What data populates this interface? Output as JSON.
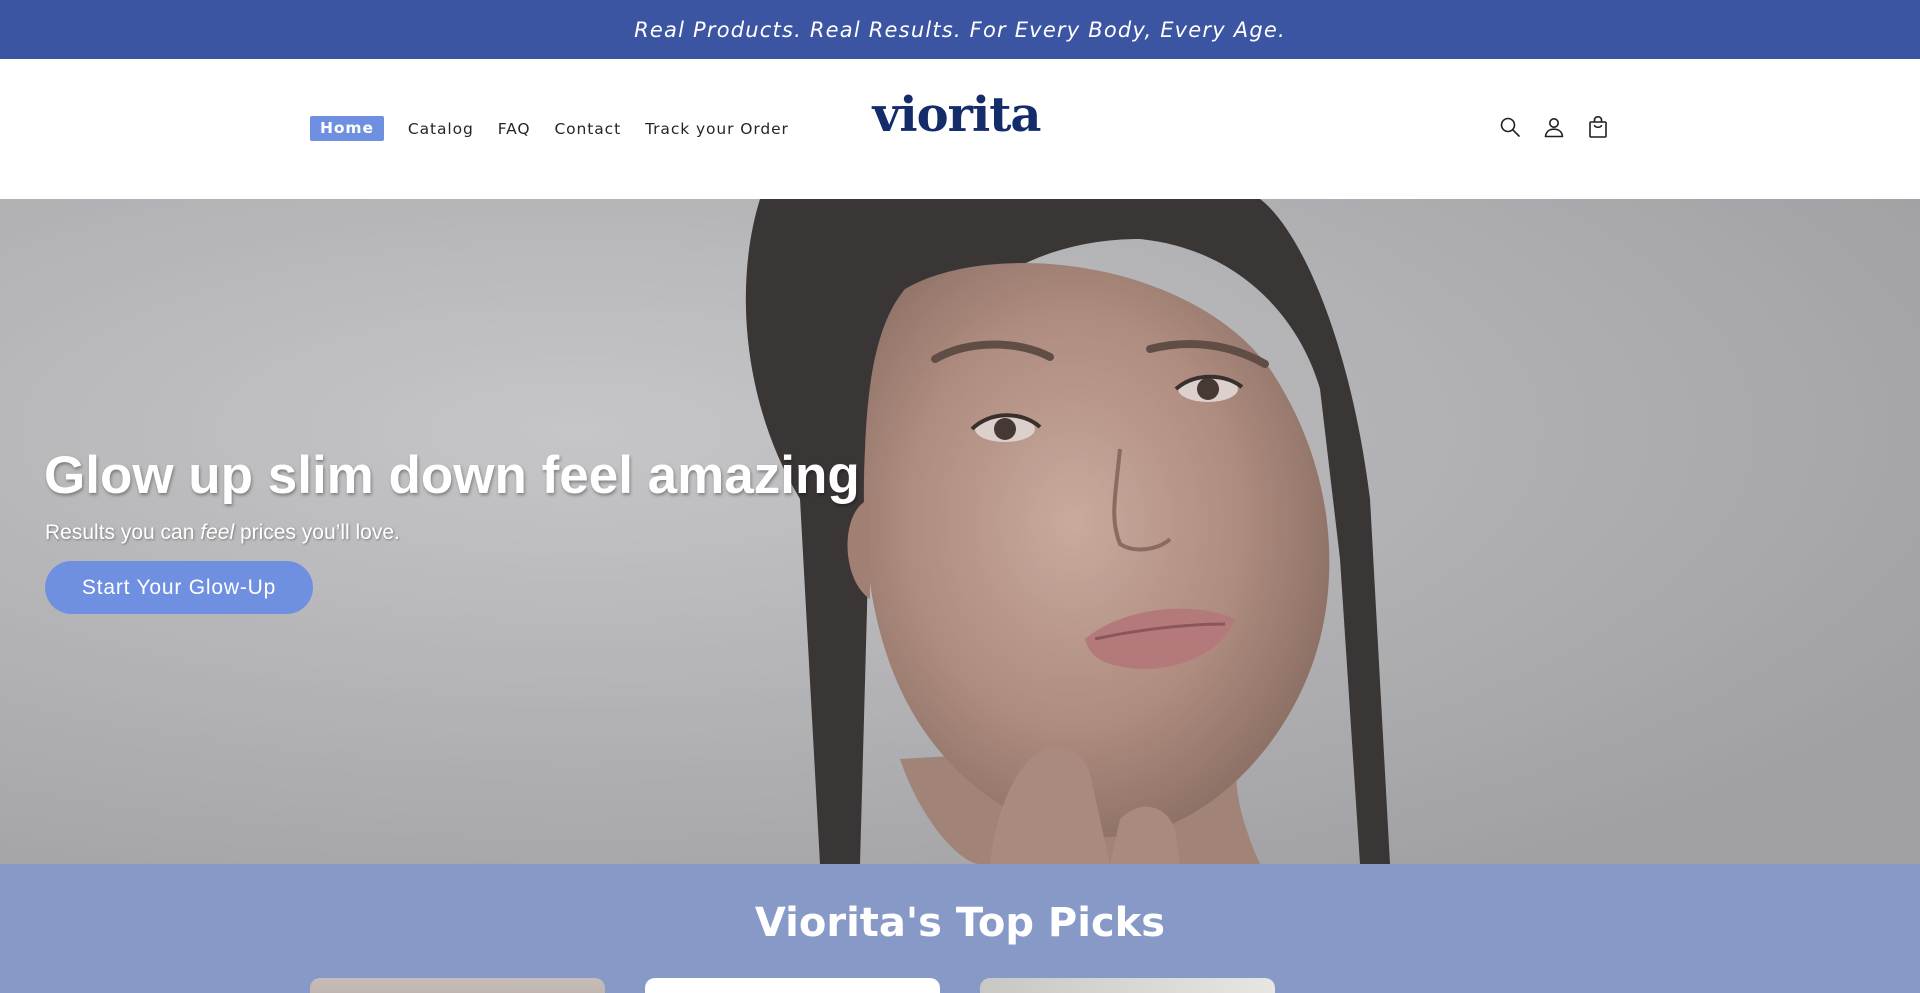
{
  "announcement": {
    "text": "Real Products. Real Results. For Every Body, Every Age."
  },
  "header": {
    "nav": [
      {
        "label": "Home",
        "active": true
      },
      {
        "label": "Catalog",
        "active": false
      },
      {
        "label": "FAQ",
        "active": false
      },
      {
        "label": "Contact",
        "active": false
      },
      {
        "label": "Track your Order",
        "active": false
      }
    ],
    "logo": "viorita",
    "icons": [
      "search-icon",
      "account-icon",
      "cart-icon"
    ]
  },
  "hero": {
    "title": "Glow up slim down feel amazing",
    "subtitle_before": "Results you can ",
    "subtitle_emphasis": "feel",
    "subtitle_after": " prices you’ll love.",
    "cta_label": "Start Your Glow-Up"
  },
  "top_picks": {
    "title": "Viorita's Top Picks"
  },
  "colors": {
    "announcement_bg": "#3c55a2",
    "accent": "#6f8fe0",
    "logo": "#142c6a",
    "picks_bg": "#8799c6"
  }
}
